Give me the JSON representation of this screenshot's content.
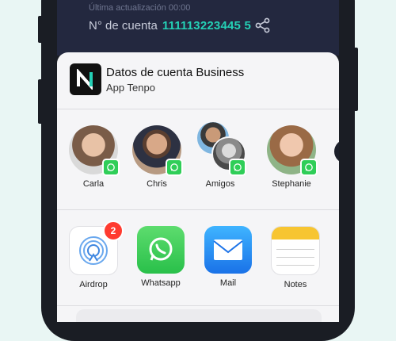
{
  "status": {
    "last_update": "Última actualización 00:00",
    "account_label": "N° de cuenta",
    "account_number": "111113223445 5"
  },
  "share_sheet": {
    "title": "Datos de cuenta Business",
    "subtitle": "App Tenpo",
    "logo_letter": "N",
    "people": [
      {
        "name": "Carla"
      },
      {
        "name": "Chris"
      },
      {
        "name": "Amigos"
      },
      {
        "name": "Stephanie"
      }
    ],
    "apps": [
      {
        "name": "Airdrop",
        "badge": "2",
        "icon": "airdrop-icon"
      },
      {
        "name": "Whatsapp",
        "icon": "whatsapp-icon"
      },
      {
        "name": "Mail",
        "icon": "mail-icon"
      },
      {
        "name": "Notes",
        "icon": "notes-icon"
      }
    ]
  },
  "colors": {
    "background": "#e9f6f4",
    "account_number": "#24d1b6",
    "whatsapp": "#2fce58",
    "badge": "#ff3b30"
  }
}
